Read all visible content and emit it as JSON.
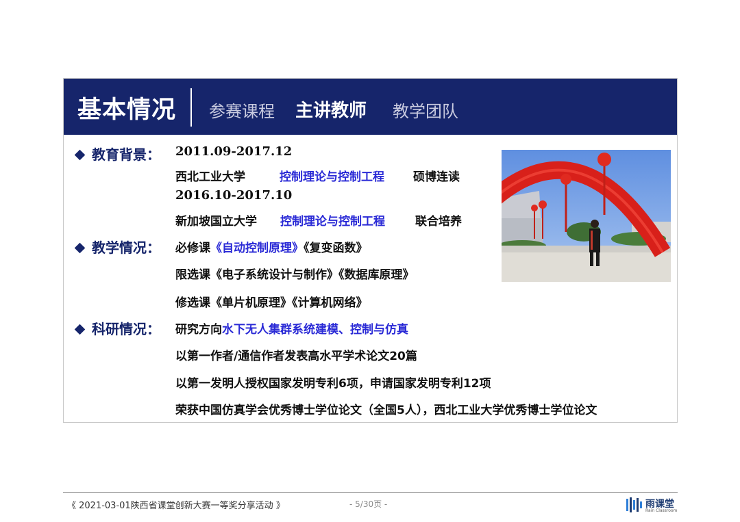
{
  "header": {
    "title": "基本情况",
    "tabs": [
      {
        "label": "参赛课程"
      },
      {
        "label": "主讲教师"
      },
      {
        "label": "教学团队"
      }
    ]
  },
  "education": {
    "label": "教育背景：",
    "period1": "2011.09-2017.12",
    "school1": "西北工业大学",
    "major1": "控制理论与控制工程",
    "degree1": "硕博连读",
    "period2": "2016.10-2017.10",
    "school2": "新加坡国立大学",
    "major2": "控制理论与控制工程",
    "degree2": "联合培养"
  },
  "teaching": {
    "label": "教学情况：",
    "required_prefix": "必修课",
    "required_blue": "《自动控制原理》",
    "required_rest": "《复变函数》",
    "elective_restricted": "限选课《电子系统设计与制作》《数据库原理》",
    "elective_optional": "修选课《单片机原理》《计算机网络》"
  },
  "research": {
    "label": "科研情况：",
    "direction_prefix": "研究方向",
    "direction_blue": "水下无人集群系统建模、控制与仿真",
    "papers": "以第一作者/通信作者发表高水平学术论文20篇",
    "patents": "以第一发明人授权国家发明专利6项，申请国家发明专利12项",
    "awards": "荣获中国仿真学会优秀博士学位论文（全国5人），西北工业大学优秀博士学位论文"
  },
  "footer": {
    "event": "《 2021-03-01陕西省课堂创新大赛一等奖分享活动 》",
    "page": "- 5/30页 -",
    "logo_text": "雨课堂",
    "logo_sub": "Rain Classroom"
  },
  "colors": {
    "header_bg": "#16256b",
    "accent_blue": "#2a2ad6"
  }
}
